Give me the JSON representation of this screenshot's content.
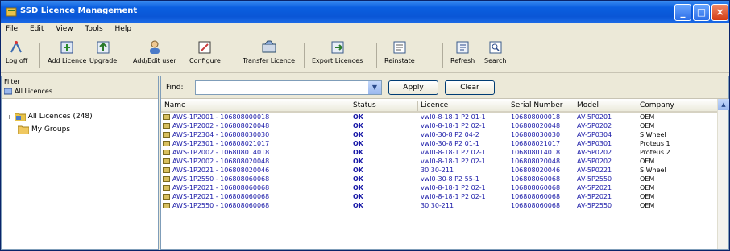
{
  "titlebar": {
    "title": "SSD Licence Management"
  },
  "menu": [
    "File",
    "Edit",
    "View",
    "Tools",
    "Help"
  ],
  "toolbar": {
    "items": [
      {
        "label": "Log off"
      },
      {
        "label": "Add Licence"
      },
      {
        "label": "Upgrade"
      },
      {
        "label": "Add/Edit user"
      },
      {
        "label": "Configure"
      },
      {
        "label": "Transfer Licence"
      },
      {
        "label": "Export Licences"
      },
      {
        "label": "Reinstate"
      },
      {
        "label": "Refresh"
      },
      {
        "label": "Search"
      }
    ]
  },
  "left": {
    "header": "Filter",
    "subheader": "All Licences",
    "tree": [
      {
        "label": "All Licences (248)"
      },
      {
        "label": "My Groups"
      }
    ]
  },
  "filter": {
    "label": "Find:",
    "value": "",
    "apply_label": "Apply",
    "clear_label": "Clear"
  },
  "columns": [
    "Name",
    "Status",
    "Licence",
    "Serial Number",
    "Model",
    "Company"
  ],
  "rows": [
    {
      "name": "AWS-1P2001 - 106808000018",
      "status": "OK",
      "licence": "vwl0-8-18-1 P2 01-1",
      "serial": "106808000018",
      "model": "AV-5P0201",
      "company": "OEM"
    },
    {
      "name": "AWS-1P2002 - 106808020048",
      "status": "OK",
      "licence": "vwl0-8-18-1 P2 02-1",
      "serial": "106808020048",
      "model": "AV-5P0202",
      "company": "OEM"
    },
    {
      "name": "AWS-1P2304 - 106808030030",
      "status": "OK",
      "licence": "vwl0-30-8 P2 04-2",
      "serial": "106808030030",
      "model": "AV-5P0304",
      "company": "S Wheel"
    },
    {
      "name": "AWS-1P2301 - 106808021017",
      "status": "OK",
      "licence": "vwl0-30-8 P2 01-1",
      "serial": "106808021017",
      "model": "AV-5P0301",
      "company": "Proteus 1"
    },
    {
      "name": "AWS-1P2002 - 106808014018",
      "status": "OK",
      "licence": "vwl0-8-18-1 P2 02-1",
      "serial": "106808014018",
      "model": "AV-5P0202",
      "company": "Proteus 2"
    },
    {
      "name": "AWS-1P2002 - 106808020048",
      "status": "OK",
      "licence": "vwl0-8-18-1 P2 02-1",
      "serial": "106808020048",
      "model": "AV-5P0202",
      "company": "OEM"
    },
    {
      "name": "AWS-1P2021 - 106808020046",
      "status": "OK",
      "licence": "30 30-211",
      "serial": "106808020046",
      "model": "AV-5P0221",
      "company": "S Wheel"
    },
    {
      "name": "AWS-1P2550 - 106808060068",
      "status": "OK",
      "licence": "vwl0-30-8 P2 55-1",
      "serial": "106808060068",
      "model": "AV-5P2550",
      "company": "OEM"
    },
    {
      "name": "AWS-1P2021 - 106808060068",
      "status": "OK",
      "licence": "vwl0-8-18-1 P2 02-1",
      "serial": "106808060068",
      "model": "AV-5P2021",
      "company": "OEM"
    },
    {
      "name": "AWS-1P2021 - 106808060068",
      "status": "OK",
      "licence": "vwl0-8-18-1 P2 02-1",
      "serial": "106808060068",
      "model": "AV-5P2021",
      "company": "OEM"
    },
    {
      "name": "AWS-1P2550 - 106808060068",
      "status": "OK",
      "licence": "30 30-211",
      "serial": "106808060068",
      "model": "AV-5P2550",
      "company": "OEM"
    }
  ]
}
